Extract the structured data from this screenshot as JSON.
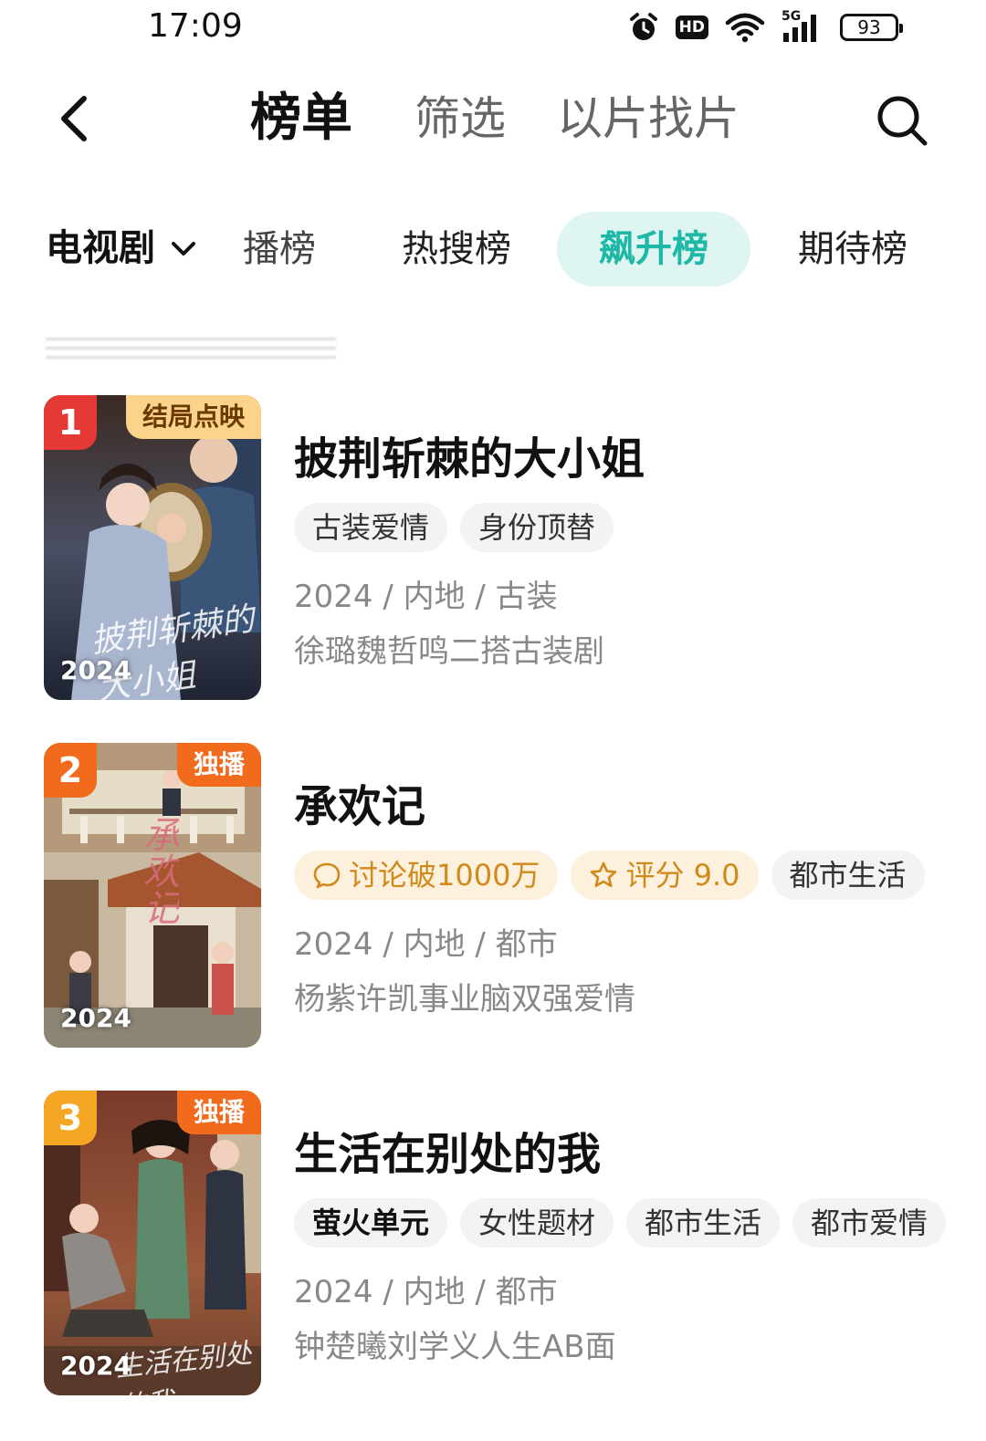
{
  "status_bar": {
    "time": "17:09",
    "hd": "HD",
    "network": "5G",
    "battery": "93",
    "icons": [
      "alarm-icon",
      "wifi-icon",
      "signal-icon",
      "battery-icon"
    ]
  },
  "header": {
    "tabs": [
      {
        "label": "榜单",
        "active": true
      },
      {
        "label": "筛选",
        "active": false
      },
      {
        "label": "以片找片",
        "active": false
      }
    ],
    "icons": [
      "back-icon",
      "search-icon"
    ]
  },
  "category": {
    "selected": "电视剧",
    "rank_tabs": [
      {
        "label": "播榜",
        "state": "faded"
      },
      {
        "label": "热搜榜",
        "state": "normal"
      },
      {
        "label": "飙升榜",
        "state": "active"
      },
      {
        "label": "期待榜",
        "state": "normal"
      }
    ]
  },
  "colors": {
    "accent": "#1db9a6",
    "accent_bg": "#dff5f2",
    "rank1": "#e53935",
    "rank2": "#f26a1b",
    "rank3": "#f5a623",
    "exclusive": "#f26a1b",
    "finale_tag_bg": "#fbd38a"
  },
  "items": [
    {
      "rank": "1",
      "corner_tag": "结局点映",
      "year": "2024",
      "title": "披荆斩棘的大小姐",
      "tags": [
        {
          "label": "古装爱情",
          "style": "plain"
        },
        {
          "label": "身份顶替",
          "style": "plain"
        }
      ],
      "meta": "2024 / 内地 / 古装",
      "desc": "徐璐魏哲鸣二搭古装剧"
    },
    {
      "rank": "2",
      "corner_tag": "独播",
      "year": "2024",
      "title": "承欢记",
      "tags": [
        {
          "label": "讨论破1000万",
          "style": "hot",
          "icon": "comment-icon"
        },
        {
          "label": "评分 9.0",
          "style": "hot",
          "icon": "star-icon"
        },
        {
          "label": "都市生活",
          "style": "plain"
        }
      ],
      "meta": "2024 / 内地 / 都市",
      "desc": "杨紫许凯事业脑双强爱情"
    },
    {
      "rank": "3",
      "corner_tag": "独播",
      "year": "2024",
      "title": "生活在别处的我",
      "tags": [
        {
          "label": "萤火单元",
          "style": "logo"
        },
        {
          "label": "女性题材",
          "style": "plain"
        },
        {
          "label": "都市生活",
          "style": "plain"
        },
        {
          "label": "都市爱情",
          "style": "plain"
        }
      ],
      "meta": "2024 / 内地 / 都市",
      "desc": "钟楚曦刘学义人生AB面"
    }
  ]
}
